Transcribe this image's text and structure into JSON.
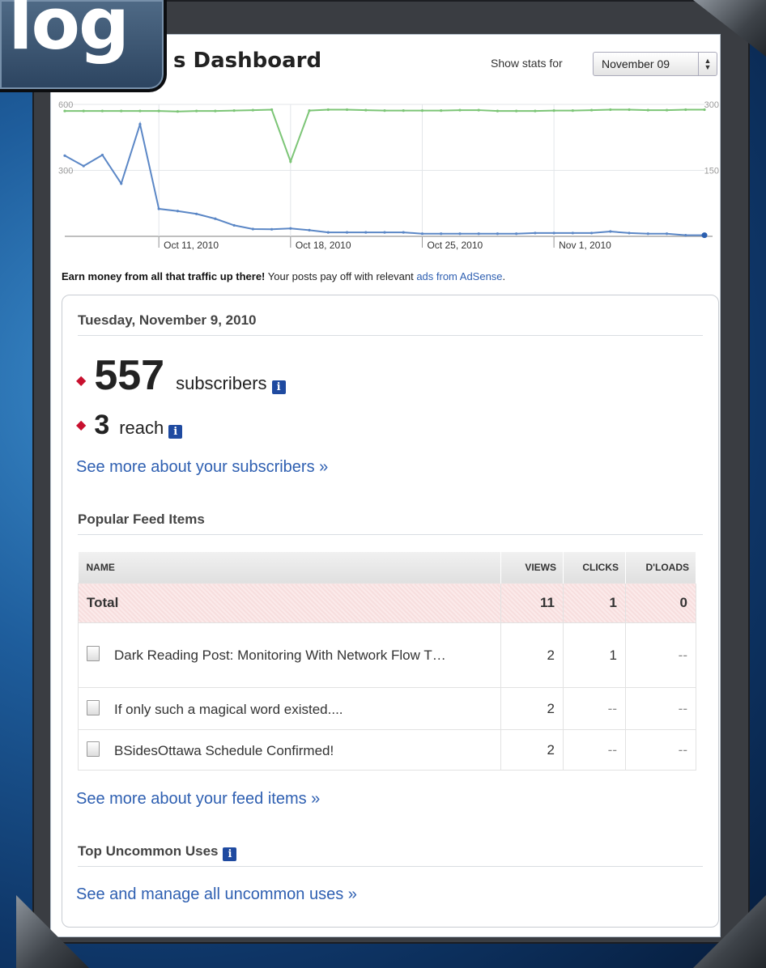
{
  "brand": {
    "logo_text": "log"
  },
  "header": {
    "title": "s Dashboard",
    "show_stats_label": "Show stats for",
    "period_selected": "November 09"
  },
  "chart_data": {
    "type": "line",
    "x": [
      "Oct 6, 2010",
      "Oct 7, 2010",
      "Oct 8, 2010",
      "Oct 9, 2010",
      "Oct 10, 2010",
      "Oct 11, 2010",
      "Oct 12, 2010",
      "Oct 13, 2010",
      "Oct 14, 2010",
      "Oct 15, 2010",
      "Oct 16, 2010",
      "Oct 17, 2010",
      "Oct 18, 2010",
      "Oct 19, 2010",
      "Oct 20, 2010",
      "Oct 21, 2010",
      "Oct 22, 2010",
      "Oct 23, 2010",
      "Oct 24, 2010",
      "Oct 25, 2010",
      "Oct 26, 2010",
      "Oct 27, 2010",
      "Oct 28, 2010",
      "Oct 29, 2010",
      "Oct 30, 2010",
      "Oct 31, 2010",
      "Nov 1, 2010",
      "Nov 2, 2010",
      "Nov 3, 2010",
      "Nov 4, 2010",
      "Nov 5, 2010",
      "Nov 6, 2010",
      "Nov 7, 2010",
      "Nov 8, 2010",
      "Nov 9, 2010"
    ],
    "xticks": [
      "Oct 11, 2010",
      "Oct 18, 2010",
      "Oct 25, 2010",
      "Nov 1, 2010"
    ],
    "ylim_left": [
      0,
      600
    ],
    "ylim_right": [
      0,
      300
    ],
    "yticks_left": [
      "600",
      "300"
    ],
    "yticks_right": [
      "300",
      "150"
    ],
    "grid": true,
    "series": [
      {
        "axis": "right",
        "color": "#7cc576",
        "values": [
          285,
          285,
          285,
          285,
          285,
          285,
          284,
          285,
          285,
          286,
          287,
          288,
          170,
          286,
          288,
          288,
          287,
          286,
          286,
          286,
          286,
          287,
          287,
          285,
          285,
          285,
          286,
          286,
          287,
          288,
          288,
          287,
          287,
          288,
          288
        ]
      },
      {
        "axis": "left",
        "color": "#5b87c6",
        "values": [
          367,
          320,
          370,
          240,
          510,
          125,
          115,
          102,
          80,
          50,
          33,
          32,
          36,
          28,
          18,
          18,
          18,
          18,
          18,
          12,
          12,
          12,
          12,
          12,
          12,
          15,
          15,
          15,
          15,
          22,
          15,
          12,
          12,
          5,
          5
        ]
      }
    ]
  },
  "earn": {
    "bold_text": "Earn money from all that traffic up there!",
    "text": " Your posts pay off with relevant ",
    "link": "ads from AdSense",
    "end": "."
  },
  "summary": {
    "date": "Tuesday, November 9, 2010",
    "subscribers_count": "557",
    "subscribers_label": "subscribers",
    "reach_count": "3",
    "reach_label": "reach",
    "info_glyph": "i",
    "see_more_subscribers": "See more about your subscribers »"
  },
  "feed": {
    "section_title": "Popular Feed Items",
    "columns": [
      "NAME",
      "VIEWS",
      "CLICKS",
      "D'LOADS"
    ],
    "total": {
      "name": "Total",
      "views": "11",
      "clicks": "1",
      "dloads": "0"
    },
    "rows": [
      {
        "name": "Dark Reading Post: Monitoring With Network Flow T…",
        "views": "2",
        "clicks": "1",
        "dloads": "--"
      },
      {
        "name": "If only such a magical word existed....",
        "views": "2",
        "clicks": "--",
        "dloads": "--"
      },
      {
        "name": "BSidesOttawa Schedule Confirmed!",
        "views": "2",
        "clicks": "--",
        "dloads": "--"
      }
    ],
    "see_more": "See more about your feed items »"
  },
  "uncommon": {
    "title": "Top Uncommon Uses",
    "link": "See and manage all uncommon uses »"
  }
}
